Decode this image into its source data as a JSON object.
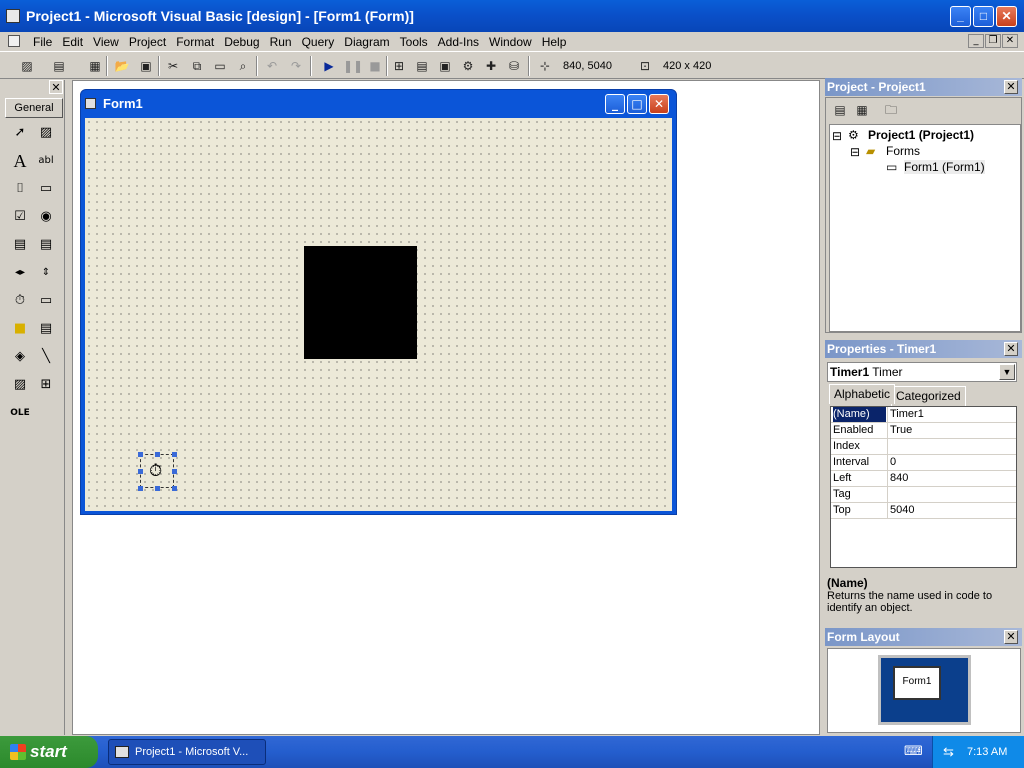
{
  "window": {
    "title": "Project1 - Microsoft Visual Basic [design] - [Form1 (Form)]"
  },
  "menu": {
    "items": [
      "File",
      "Edit",
      "View",
      "Project",
      "Format",
      "Debug",
      "Run",
      "Query",
      "Diagram",
      "Tools",
      "Add-Ins",
      "Window",
      "Help"
    ]
  },
  "toolbar": {
    "position": "840, 5040",
    "size": "420 x 420"
  },
  "toolbox": {
    "tab": "General"
  },
  "form": {
    "title": "Form1"
  },
  "project": {
    "title": "Project - Project1",
    "nodes": [
      "Project1 (Project1)",
      "Forms",
      "Form1 (Form1)"
    ]
  },
  "properties": {
    "title": "Properties - Timer1",
    "object_name": "Timer1",
    "object_type": "Timer",
    "tabs": [
      "Alphabetic",
      "Categorized"
    ],
    "rows": [
      {
        "name": "(Name)",
        "value": "Timer1"
      },
      {
        "name": "Enabled",
        "value": "True"
      },
      {
        "name": "Index",
        "value": ""
      },
      {
        "name": "Interval",
        "value": "0"
      },
      {
        "name": "Left",
        "value": "840"
      },
      {
        "name": "Tag",
        "value": ""
      },
      {
        "name": "Top",
        "value": "5040"
      }
    ],
    "desc_title": "(Name)",
    "desc_text": "Returns the name used in code to identify an object."
  },
  "layout": {
    "title": "Form Layout",
    "form_label": "Form1"
  },
  "taskbar": {
    "start": "start",
    "task": "Project1 - Microsoft V...",
    "time": "7:13 AM"
  }
}
